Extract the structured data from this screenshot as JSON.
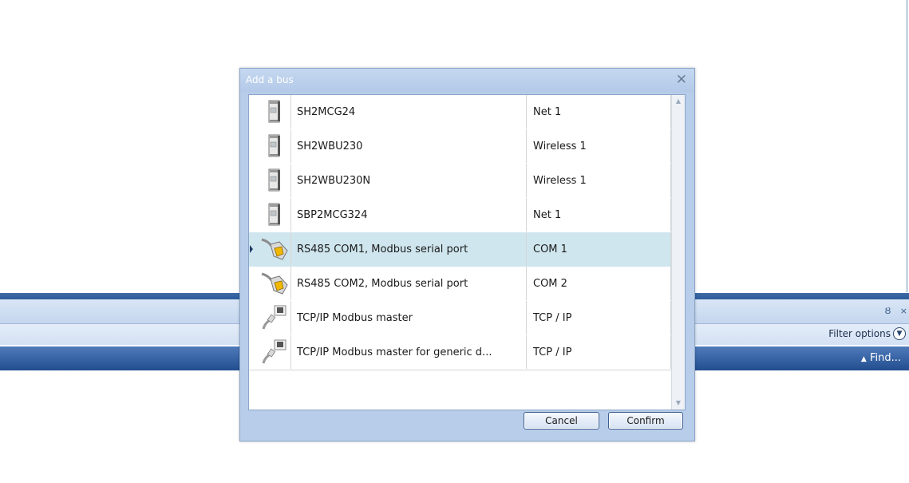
{
  "app": {
    "filter_options_label": "Filter options",
    "filter_options_icon": "chevron-down-circle-icon",
    "find_label": "Find...",
    "find_icon": "triangle-up-icon",
    "pin_icon": "Ȣ",
    "close_icon": "×"
  },
  "dialog": {
    "title": "Add a bus",
    "close_glyph": "✕",
    "rows": [
      {
        "name": "SH2MCG24",
        "port": "Net 1",
        "icon": "device-module-icon",
        "selected": false
      },
      {
        "name": "SH2WBU230",
        "port": "Wireless 1",
        "icon": "device-module-icon",
        "selected": false
      },
      {
        "name": "SH2WBU230N",
        "port": "Wireless 1",
        "icon": "device-module-icon",
        "selected": false
      },
      {
        "name": "SBP2MCG324",
        "port": "Net 1",
        "icon": "device-module-icon",
        "selected": false
      },
      {
        "name": "RS485 COM1, Modbus serial port",
        "port": "COM 1",
        "icon": "serial-connector-icon",
        "selected": true
      },
      {
        "name": "RS485 COM2, Modbus serial port",
        "port": "COM 2",
        "icon": "serial-connector-icon",
        "selected": false
      },
      {
        "name": "TCP/IP Modbus master",
        "port": "TCP / IP",
        "icon": "ethernet-cable-icon",
        "selected": false
      },
      {
        "name": "TCP/IP Modbus master for generic d...",
        "port": "TCP / IP",
        "icon": "ethernet-cable-icon",
        "selected": false
      }
    ],
    "cancel_label": "Cancel",
    "confirm_label": "Confirm"
  },
  "colors": {
    "selected_row": "#cfe6ee",
    "dialog_bg": "#b8cde9",
    "ribbon_blue": "#2d5b9a"
  }
}
